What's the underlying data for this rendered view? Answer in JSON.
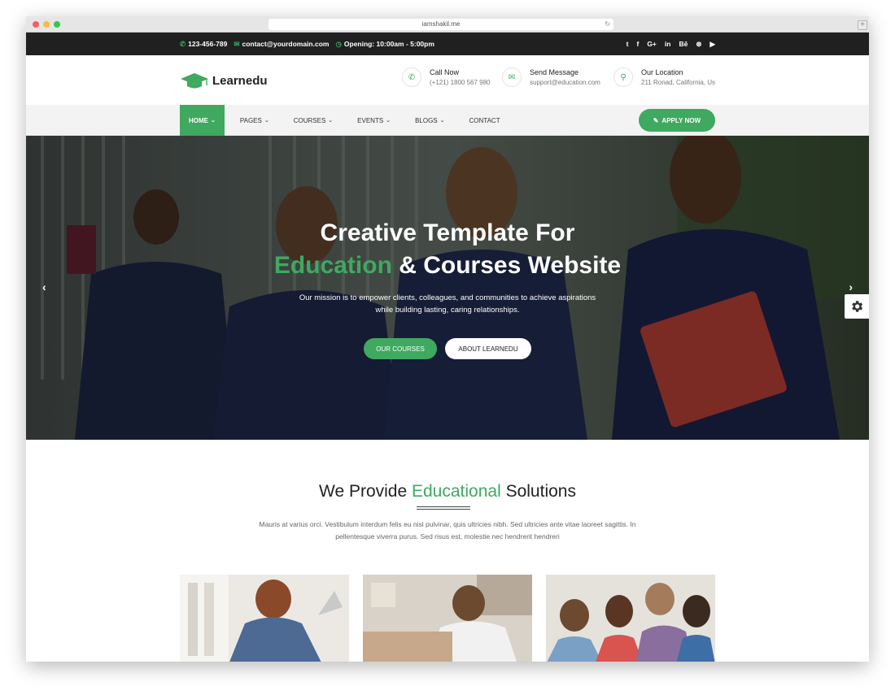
{
  "browser": {
    "url": "iamshakil.me"
  },
  "topbar": {
    "phone": "123-456-789",
    "email": "contact@yourdomain.com",
    "hours": "Opening: 10:00am - 5:00pm",
    "social_icons": [
      "twitter-icon",
      "facebook-icon",
      "google-plus-icon",
      "linkedin-icon",
      "behance-icon",
      "dribbble-icon",
      "youtube-icon"
    ],
    "social_glyphs": {
      "twitter": "t",
      "facebook": "f",
      "google": "G+",
      "linkedin": "in",
      "behance": "Bē",
      "dribbble": "⊛",
      "youtube": "▶"
    }
  },
  "header": {
    "logo_text": "Learnedu",
    "call_title": "Call Now",
    "call_value": "(+121) 1800 567 980",
    "message_title": "Send Message",
    "message_value": "support@education.com",
    "location_title": "Our Location",
    "location_value": "211 Ronad, California, Us"
  },
  "nav": {
    "items": [
      "HOME",
      "PAGES",
      "COURSES",
      "EVENTS",
      "BLOGS",
      "CONTACT"
    ],
    "active": "HOME",
    "apply_label": "APPLY NOW"
  },
  "hero": {
    "title_line1": "Creative Template For",
    "title_accent": "Education",
    "title_rest": " & Courses Website",
    "subtitle": "Our mission is to empower clients, colleagues, and communities to achieve aspirations while building lasting, caring relationships.",
    "button_primary": "OUR COURSES",
    "button_secondary": "ABOUT LEARNEDU"
  },
  "solutions": {
    "title_pre": "We Provide ",
    "title_accent": "Educational",
    "title_post": " Solutions",
    "description": "Mauris at varius orci. Vestibulum interdum felis eu nisl pulvinar, quis ultricies nibh. Sed ultricies ante vitae laoreet sagittis. In pellentesque viverra purus. Sed risus est, molestie nec hendrerit hendreri"
  },
  "colors": {
    "accent": "#3fa95f",
    "topbar": "#202020",
    "nav": "#f3f3f3"
  }
}
